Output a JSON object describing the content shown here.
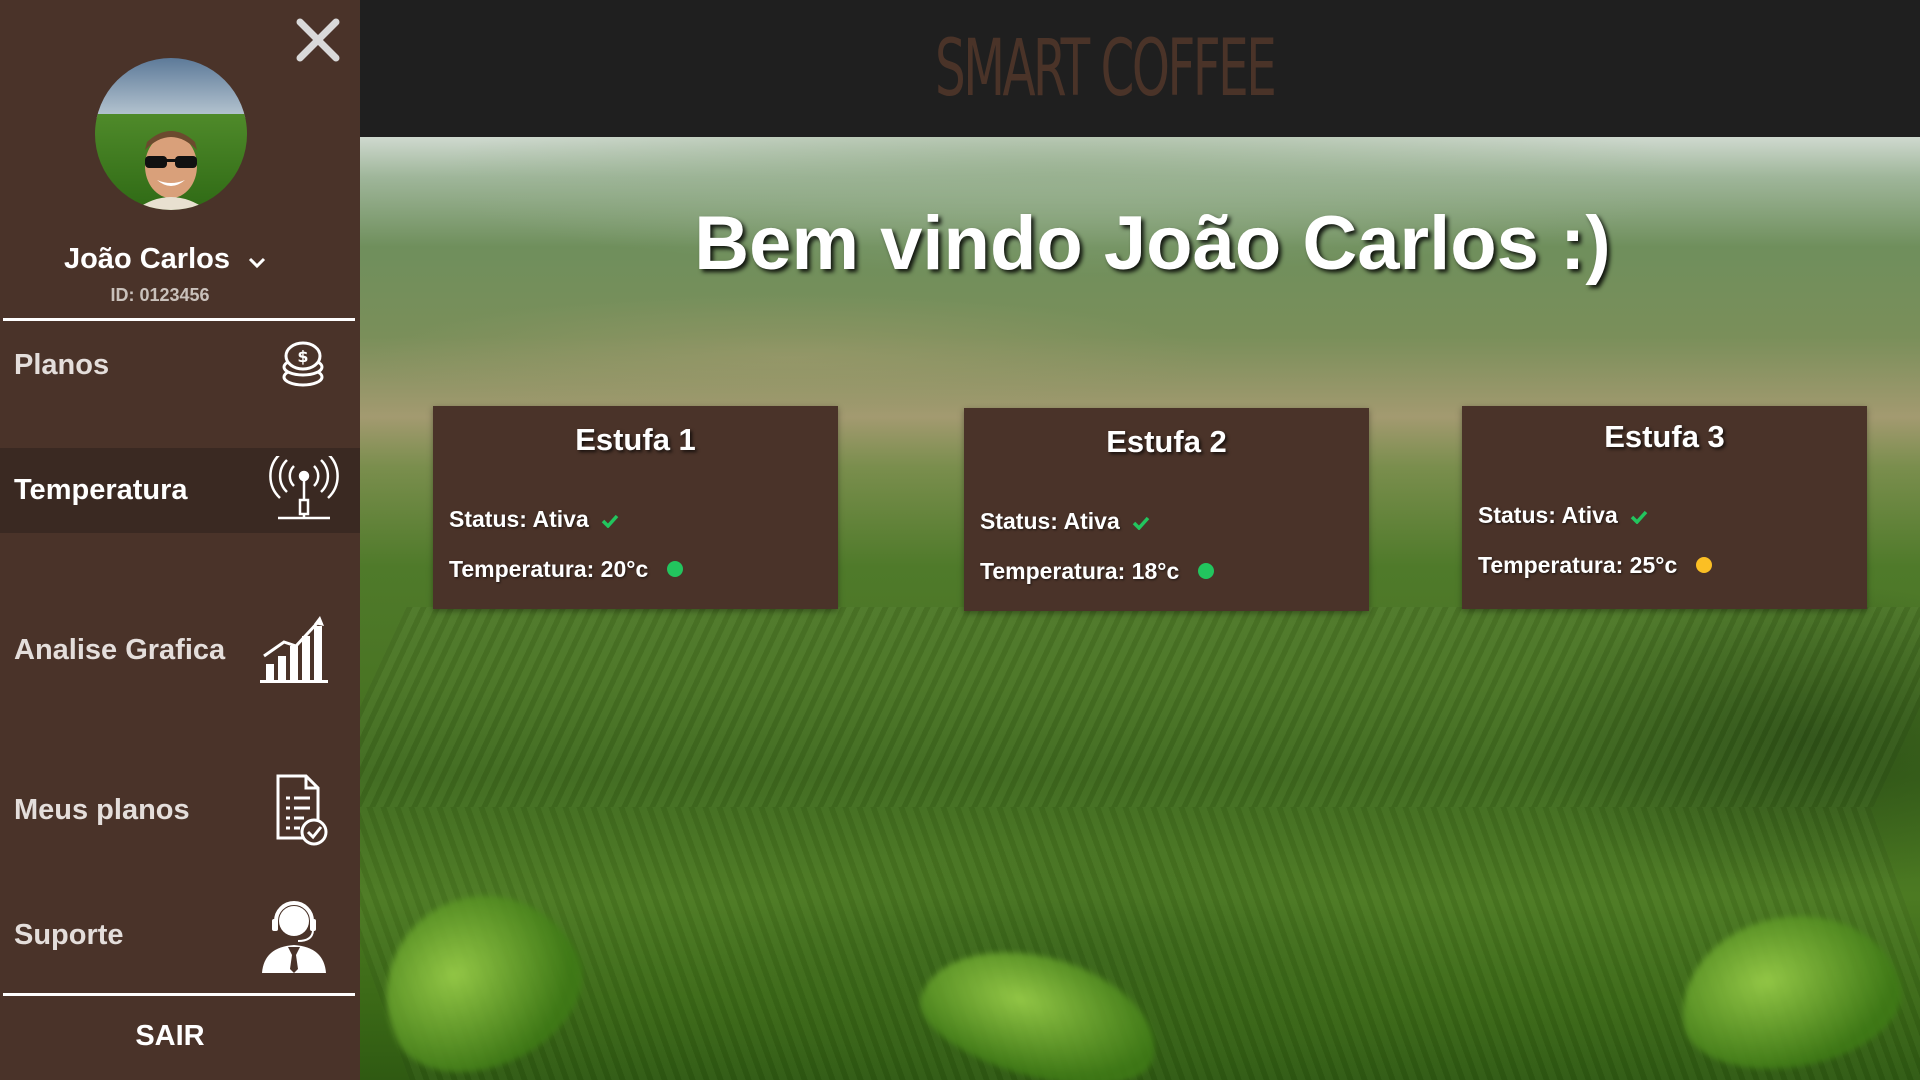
{
  "header": {
    "brand": "SMART COFFEE"
  },
  "sidebar": {
    "user_name": "João Carlos",
    "user_id": "ID: 0123456",
    "items": [
      {
        "label": "Planos",
        "icon": "coins-icon"
      },
      {
        "label": "Temperatura",
        "icon": "antenna-icon",
        "active": true
      },
      {
        "label": "Analise Grafica",
        "icon": "bar-chart-icon"
      },
      {
        "label": "Meus planos",
        "icon": "document-check-icon"
      },
      {
        "label": "Suporte",
        "icon": "support-agent-icon"
      }
    ],
    "logout_label": "SAIR"
  },
  "main": {
    "welcome": "Bem vindo João Carlos :)",
    "cards": [
      {
        "title": "Estufa 1",
        "status": "Status: Ativa",
        "temperature": "Temperatura: 20°c",
        "indicator_color": "#22c55e"
      },
      {
        "title": "Estufa 2",
        "status": "Status: Ativa",
        "temperature": "Temperatura: 18°c",
        "indicator_color": "#22c55e"
      },
      {
        "title": "Estufa 3",
        "status": "Status: Ativa",
        "temperature": "Temperatura: 25°c",
        "indicator_color": "#fbbf24"
      }
    ]
  },
  "colors": {
    "sidebar_bg": "#4a3329",
    "header_bg": "#1f1f1f",
    "card_bg": "#4a3329",
    "check_green": "#22c55e"
  }
}
